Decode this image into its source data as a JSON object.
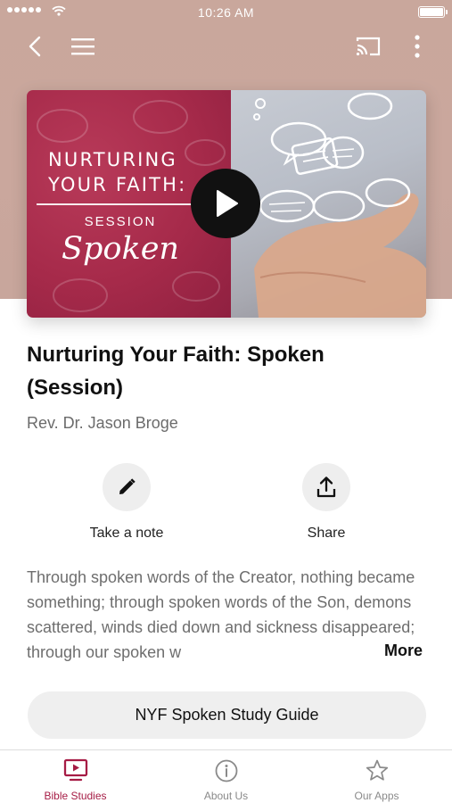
{
  "status_bar": {
    "time": "10:26 AM"
  },
  "nav": {
    "back_icon": "chevron-left-icon",
    "menu_icon": "hamburger-menu-icon",
    "cast_icon": "cast-icon",
    "more_icon": "more-vertical-icon"
  },
  "hero": {
    "title_line1": "NURTURING",
    "title_line2": "YOUR FAITH:",
    "session_label": "SESSION",
    "session_word": "Spoken",
    "play_icon": "play-icon",
    "accent_color": "#a62a4a"
  },
  "content": {
    "title": "Nurturing Your Faith: Spoken (Session)",
    "author": "Rev. Dr. Jason Broge",
    "description": "Through spoken words of the Creator, nothing became something; through spoken words of the Son, demons scattered, winds died down and sickness disappeared; through our spoken w",
    "more_label": "More",
    "study_guide_label": "NYF Spoken Study Guide"
  },
  "actions": {
    "note_label": "Take a note",
    "note_icon": "pencil-icon",
    "share_label": "Share",
    "share_icon": "share-icon"
  },
  "tabs": [
    {
      "label": "Bible Studies",
      "icon": "tv-play-icon",
      "active": true
    },
    {
      "label": "About Us",
      "icon": "info-icon",
      "active": false
    },
    {
      "label": "Our Apps",
      "icon": "star-icon",
      "active": false
    }
  ],
  "colors": {
    "brand": "#a61c45",
    "inactive": "#8a8a8a"
  }
}
